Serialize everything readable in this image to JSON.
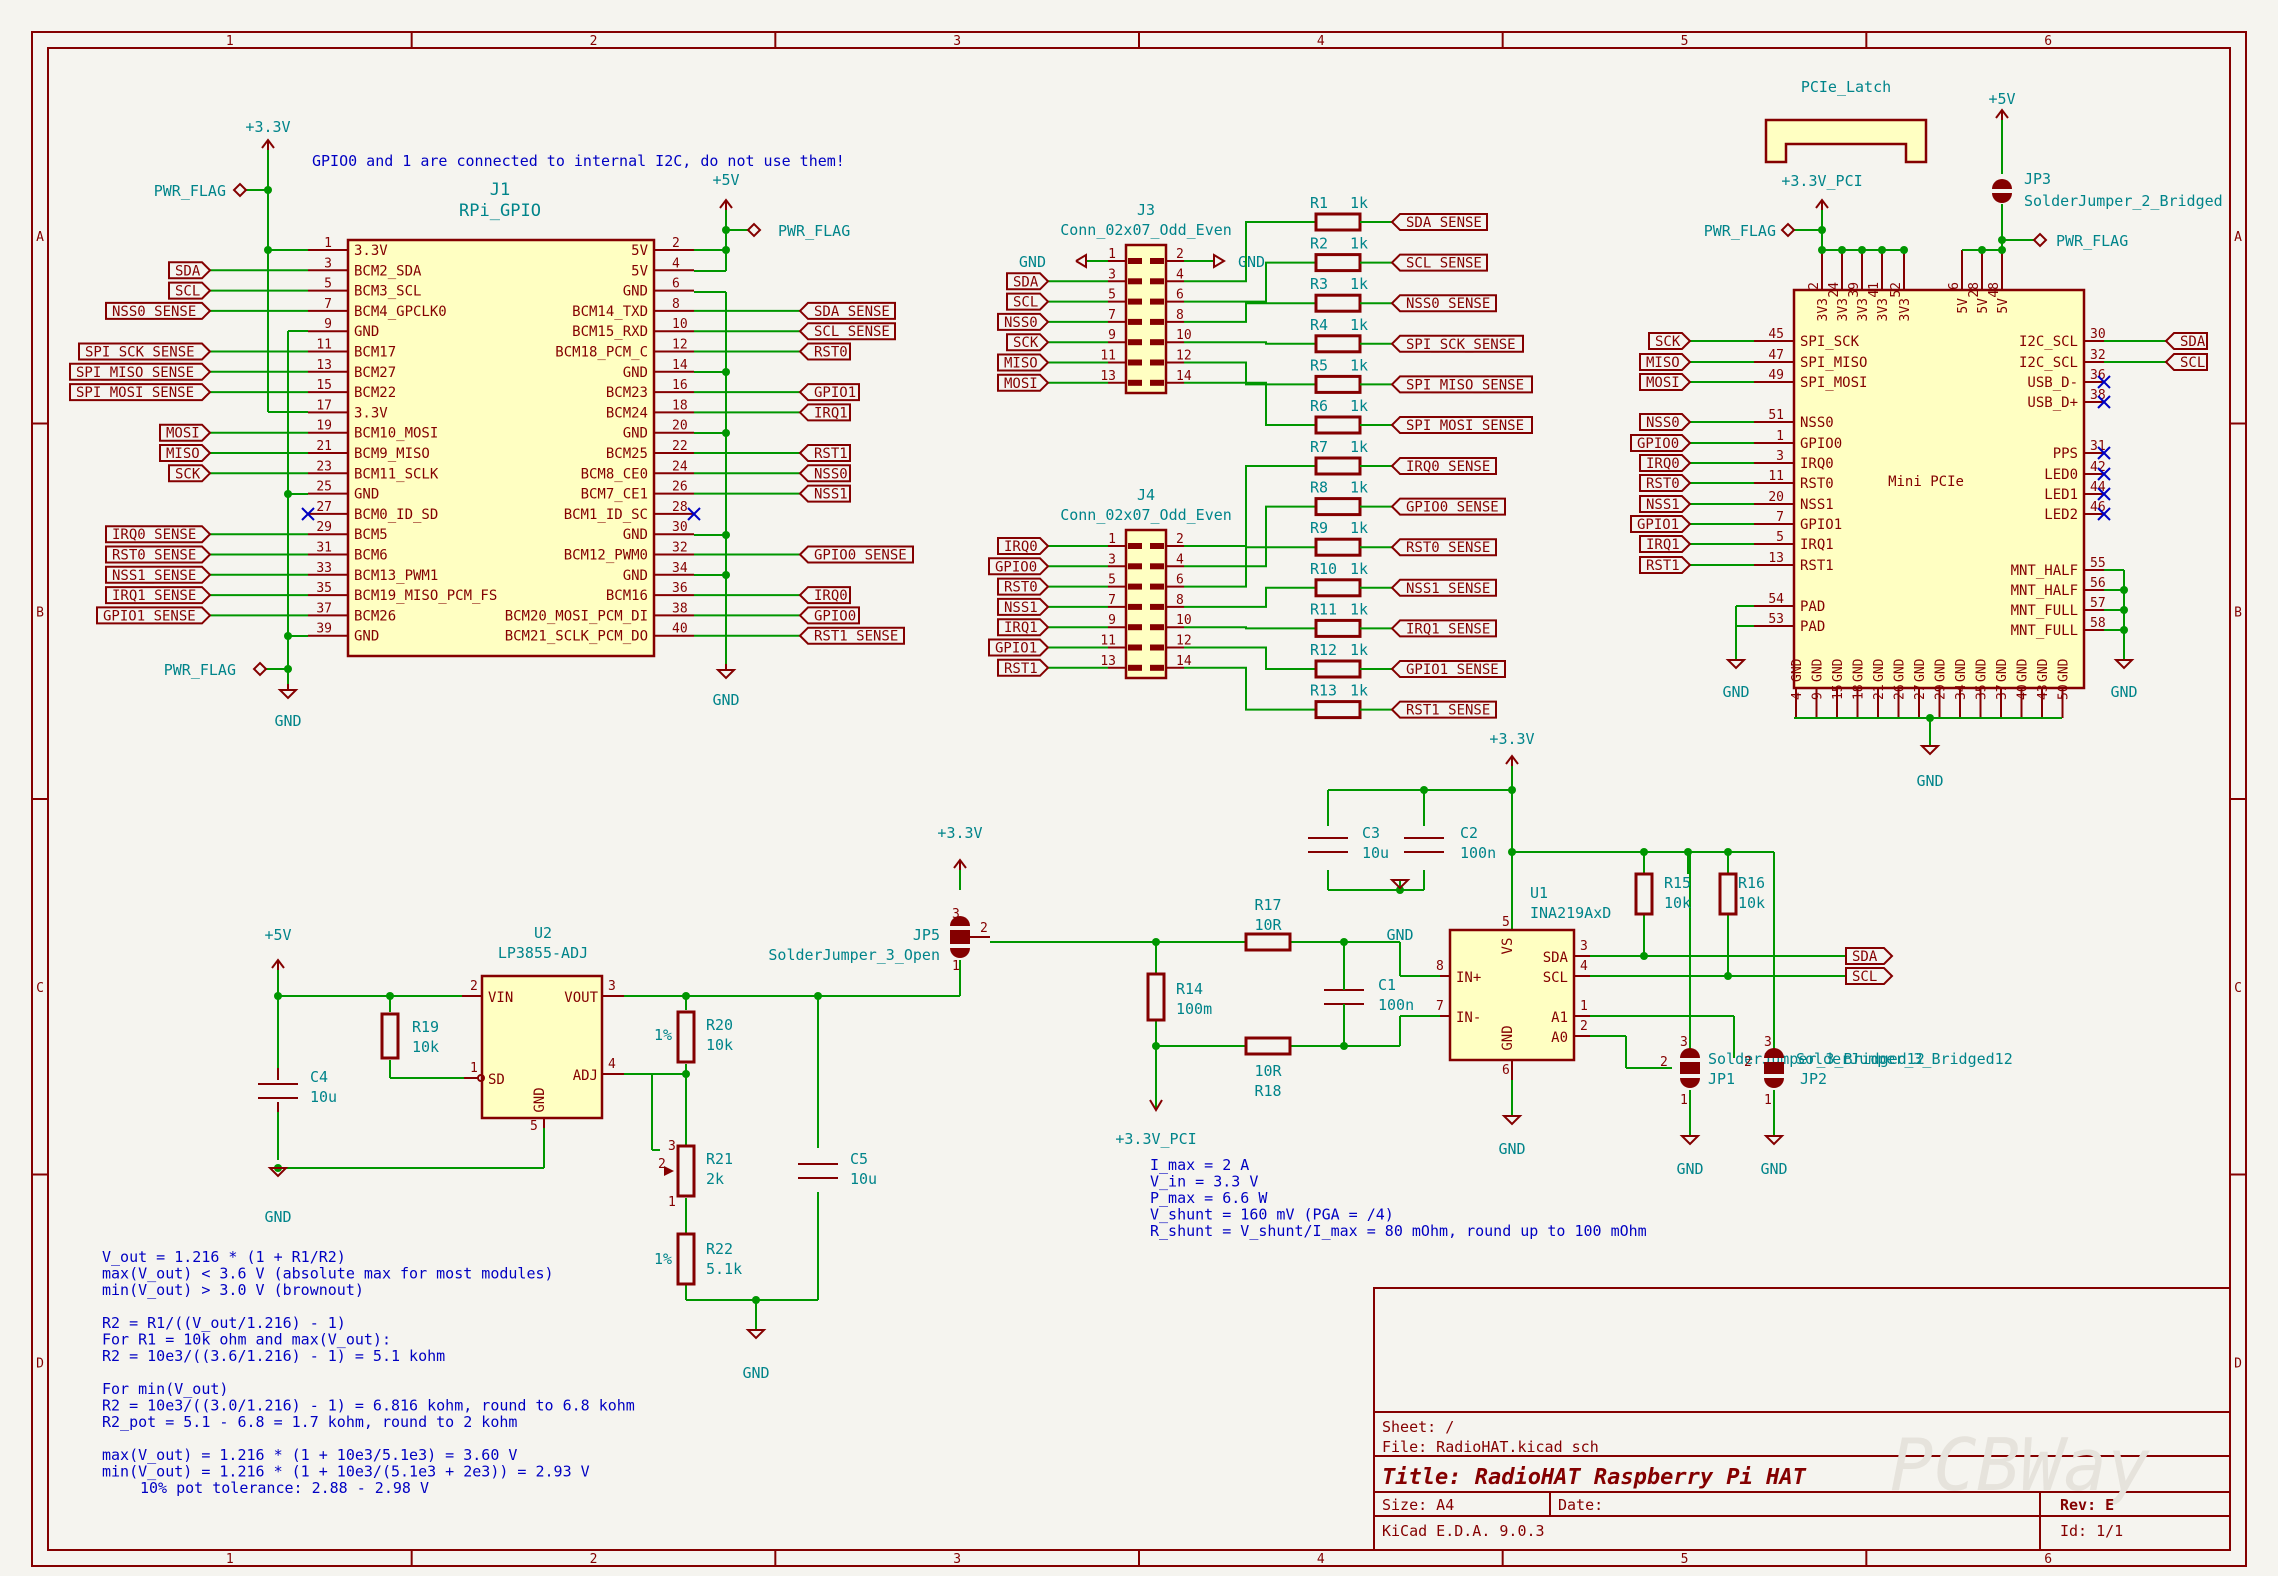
{
  "frame": {
    "cols": [
      "1",
      "2",
      "3",
      "4",
      "5",
      "6"
    ],
    "rows": [
      "A",
      "B",
      "C",
      "D"
    ]
  },
  "title_block": {
    "sheet": "Sheet: /",
    "file": "File: RadioHAT.kicad_sch",
    "title": "Title: RadioHAT Raspberry Pi HAT",
    "size": "Size: A4",
    "date": "Date:",
    "rev": "Rev: E",
    "tool": "KiCad E.D.A. 9.0.3",
    "id": "Id: 1/1",
    "watermark": "PCBWay"
  },
  "power": {
    "p33": "+3.3V",
    "p5": "+5V",
    "gnd": "GND",
    "p33pci": "+3.3V_PCI",
    "pwrflag": "PWR_FLAG"
  },
  "j1": {
    "ref": "J1",
    "value": "RPi_GPIO",
    "note": "GPIO0 and 1 are connected to internal I2C, do not use them!",
    "left": [
      {
        "n": "1",
        "t": "3.3V"
      },
      {
        "n": "3",
        "t": "BCM2_SDA"
      },
      {
        "n": "5",
        "t": "BCM3_SCL"
      },
      {
        "n": "7",
        "t": "BCM4_GPCLK0"
      },
      {
        "n": "9",
        "t": "GND"
      },
      {
        "n": "11",
        "t": "BCM17"
      },
      {
        "n": "13",
        "t": "BCM27"
      },
      {
        "n": "15",
        "t": "BCM22"
      },
      {
        "n": "17",
        "t": "3.3V"
      },
      {
        "n": "19",
        "t": "BCM10_MOSI"
      },
      {
        "n": "21",
        "t": "BCM9_MISO"
      },
      {
        "n": "23",
        "t": "BCM11_SCLK"
      },
      {
        "n": "25",
        "t": "GND"
      },
      {
        "n": "27",
        "t": "BCM0_ID_SD"
      },
      {
        "n": "29",
        "t": "BCM5"
      },
      {
        "n": "31",
        "t": "BCM6"
      },
      {
        "n": "33",
        "t": "BCM13_PWM1"
      },
      {
        "n": "35",
        "t": "BCM19_MISO_PCM_FS"
      },
      {
        "n": "37",
        "t": "BCM26"
      },
      {
        "n": "39",
        "t": "GND"
      }
    ],
    "right": [
      {
        "n": "2",
        "t": "5V"
      },
      {
        "n": "4",
        "t": "5V"
      },
      {
        "n": "6",
        "t": "GND"
      },
      {
        "n": "8",
        "t": "BCM14_TXD"
      },
      {
        "n": "10",
        "t": "BCM15_RXD"
      },
      {
        "n": "12",
        "t": "BCM18_PCM_C"
      },
      {
        "n": "14",
        "t": "GND"
      },
      {
        "n": "16",
        "t": "BCM23"
      },
      {
        "n": "18",
        "t": "BCM24"
      },
      {
        "n": "20",
        "t": "GND"
      },
      {
        "n": "22",
        "t": "BCM25"
      },
      {
        "n": "24",
        "t": "BCM8_CE0"
      },
      {
        "n": "26",
        "t": "BCM7_CE1"
      },
      {
        "n": "28",
        "t": "BCM1_ID_SC"
      },
      {
        "n": "30",
        "t": "GND"
      },
      {
        "n": "32",
        "t": "BCM12_PWM0"
      },
      {
        "n": "34",
        "t": "GND"
      },
      {
        "n": "36",
        "t": "BCM16"
      },
      {
        "n": "38",
        "t": "BCM20_MOSI_PCM_DI"
      },
      {
        "n": "40",
        "t": "BCM21_SCLK_PCM_DO"
      }
    ],
    "left_labels": [
      "",
      "SDA",
      "SCL",
      "NSS0_SENSE",
      "",
      "SPI_SCK_SENSE",
      "SPI_MISO_SENSE",
      "SPI_MOSI_SENSE",
      "",
      "MOSI",
      "MISO",
      "SCK",
      "",
      "",
      "IRQ0_SENSE",
      "RST0_SENSE",
      "NSS1_SENSE",
      "IRQ1_SENSE",
      "GPIO1_SENSE",
      ""
    ],
    "right_labels": [
      "",
      "",
      "",
      "SDA_SENSE",
      "SCL_SENSE",
      "RST0",
      "",
      "GPIO1",
      "IRQ1",
      "",
      "RST1",
      "NSS0",
      "NSS1",
      "",
      "",
      "GPIO0_SENSE",
      "",
      "IRQ0",
      "GPIO0",
      "RST1_SENSE"
    ]
  },
  "j3": {
    "ref": "J3",
    "value": "Conn_02x07_Odd_Even",
    "left_pins": [
      "1",
      "3",
      "5",
      "7",
      "9",
      "11",
      "13"
    ],
    "right_pins": [
      "2",
      "4",
      "6",
      "8",
      "10",
      "12",
      "14"
    ],
    "left_labels": [
      "",
      "SDA",
      "SCL",
      "NSS0",
      "SCK",
      "MISO",
      "MOSI"
    ],
    "gnd": "GND",
    "resistors": [
      {
        "ref": "R1",
        "val": "1k",
        "net": "SDA_SENSE"
      },
      {
        "ref": "R2",
        "val": "1k",
        "net": "SCL_SENSE"
      },
      {
        "ref": "R3",
        "val": "1k",
        "net": "NSS0_SENSE"
      },
      {
        "ref": "R4",
        "val": "1k",
        "net": "SPI_SCK_SENSE"
      },
      {
        "ref": "R5",
        "val": "1k",
        "net": "SPI_MISO_SENSE"
      },
      {
        "ref": "R6",
        "val": "1k",
        "net": "SPI_MOSI_SENSE"
      }
    ]
  },
  "j4": {
    "ref": "J4",
    "value": "Conn_02x07_Odd_Even",
    "left_pins": [
      "1",
      "3",
      "5",
      "7",
      "9",
      "11",
      "13"
    ],
    "right_pins": [
      "2",
      "4",
      "6",
      "8",
      "10",
      "12",
      "14"
    ],
    "left_labels": [
      "IRQ0",
      "GPIO0",
      "RST0",
      "NSS1",
      "IRQ1",
      "GPIO1",
      "RST1"
    ],
    "resistors": [
      {
        "ref": "R7",
        "val": "1k",
        "net": "IRQ0_SENSE"
      },
      {
        "ref": "R8",
        "val": "1k",
        "net": "GPIO0_SENSE"
      },
      {
        "ref": "R9",
        "val": "1k",
        "net": "RST0_SENSE"
      },
      {
        "ref": "R10",
        "val": "1k",
        "net": "NSS1_SENSE"
      },
      {
        "ref": "R11",
        "val": "1k",
        "net": "IRQ1_SENSE"
      },
      {
        "ref": "R12",
        "val": "1k",
        "net": "GPIO1_SENSE"
      },
      {
        "ref": "R13",
        "val": "1k",
        "net": "RST1_SENSE"
      }
    ]
  },
  "pcie": {
    "latch": "PCIe_Latch",
    "value": "Mini PCIe",
    "jp3_ref": "JP3",
    "jp3_val": "SolderJumper_2_Bridged",
    "top_pins": [
      "2",
      "24",
      "39",
      "41",
      "52",
      "6",
      "28",
      "48"
    ],
    "top_names": [
      "3V3",
      "3V3",
      "3V3",
      "3V3",
      "3V3",
      "5V",
      "5V",
      "5V"
    ],
    "left": [
      {
        "n": "45",
        "t": "SPI_SCK",
        "l": "SCK"
      },
      {
        "n": "47",
        "t": "SPI_MISO",
        "l": "MISO"
      },
      {
        "n": "49",
        "t": "SPI_MOSI",
        "l": "MOSI"
      },
      {
        "n": "51",
        "t": "NSS0",
        "l": "NSS0"
      },
      {
        "n": "1",
        "t": "GPIO0",
        "l": "GPIO0"
      },
      {
        "n": "3",
        "t": "IRQ0",
        "l": "IRQ0"
      },
      {
        "n": "11",
        "t": "RST0",
        "l": "RST0"
      },
      {
        "n": "20",
        "t": "NSS1",
        "l": "NSS1"
      },
      {
        "n": "7",
        "t": "GPIO1",
        "l": "GPIO1"
      },
      {
        "n": "5",
        "t": "IRQ1",
        "l": "IRQ1"
      },
      {
        "n": "13",
        "t": "RST1",
        "l": "RST1"
      }
    ],
    "pad": [
      {
        "n": "54",
        "t": "PAD"
      },
      {
        "n": "53",
        "t": "PAD"
      }
    ],
    "right": [
      {
        "n": "30",
        "t": "I2C_SCL",
        "l": "SDA"
      },
      {
        "n": "32",
        "t": "I2C_SCL",
        "l": "SCL"
      },
      {
        "n": "36",
        "t": "USB_D-",
        "l": ""
      },
      {
        "n": "38",
        "t": "USB_D+",
        "l": ""
      },
      {
        "n": "31",
        "t": "PPS",
        "l": ""
      },
      {
        "n": "42",
        "t": "LED0",
        "l": ""
      },
      {
        "n": "44",
        "t": "LED1",
        "l": ""
      },
      {
        "n": "46",
        "t": "LED2",
        "l": ""
      },
      {
        "n": "55",
        "t": "MNT_HALF",
        "l": ""
      },
      {
        "n": "56",
        "t": "MNT_HALF",
        "l": ""
      },
      {
        "n": "57",
        "t": "MNT_FULL",
        "l": ""
      },
      {
        "n": "58",
        "t": "MNT_FULL",
        "l": ""
      }
    ],
    "bottom_pins": [
      "4",
      "9",
      "15",
      "18",
      "21",
      "26",
      "27",
      "29",
      "34",
      "35",
      "37",
      "40",
      "43",
      "50"
    ],
    "gnd_name": "GND"
  },
  "ina": {
    "u1_ref": "U1",
    "u1_val": "INA219AxD",
    "vs": "VS",
    "inp": "IN+",
    "inn": "IN-",
    "sda": "SDA",
    "scl": "SCL",
    "a1": "A1",
    "a0": "A0",
    "gndpin": "GND",
    "pins": {
      "vs": "5",
      "inp": "8",
      "inn": "7",
      "sda": "3",
      "scl": "4",
      "a1": "1",
      "a0": "2",
      "gnd": "6"
    },
    "c3": {
      "ref": "C3",
      "val": "10u"
    },
    "c2": {
      "ref": "C2",
      "val": "100n"
    },
    "c1": {
      "ref": "C1",
      "val": "100n"
    },
    "r15": {
      "ref": "R15",
      "val": "10k"
    },
    "r16": {
      "ref": "R16",
      "val": "10k"
    },
    "r17": {
      "ref": "R17",
      "val": "10R"
    },
    "r18": {
      "ref": "R18",
      "val": "10R"
    },
    "r14": {
      "ref": "R14",
      "val": "100m"
    },
    "jp1": "JP1",
    "jp2": "JP2",
    "jp_val": "SolderJumper_3_Bridged12",
    "jp_val_overlap": "SolderJumper_3_Bridged12",
    "sda_lbl": "SDA",
    "scl_lbl": "SCL",
    "notes": [
      "I_max = 2 A",
      "V_in = 3.3 V",
      "P_max = 6.6 W",
      "V_shunt = 160 mV (PGA = /4)",
      "R_shunt = V_shunt/I_max = 80 mOhm, round up to 100 mOhm"
    ]
  },
  "ldo": {
    "u2_ref": "U2",
    "u2_val": "LP3855-ADJ",
    "vin": "VIN",
    "vout": "VOUT",
    "sd": "SD",
    "adj": "ADJ",
    "gndp": "GND",
    "pins": {
      "vin": "2",
      "vout": "3",
      "sd": "1",
      "adj": "4",
      "gnd": "5"
    },
    "c4": {
      "ref": "C4",
      "val": "10u"
    },
    "c5": {
      "ref": "C5",
      "val": "10u"
    },
    "r19": {
      "ref": "R19",
      "val": "10k"
    },
    "r20": {
      "ref": "R20",
      "val": "10k",
      "tol": "1%"
    },
    "r21": {
      "ref": "R21",
      "val": "2k"
    },
    "r22": {
      "ref": "R22",
      "val": "5.1k",
      "tol": "1%"
    },
    "jp5_ref": "JP5",
    "jp5_val": "SolderJumper_3_Open",
    "notes": [
      "V_out = 1.216 * (1 + R1/R2)",
      "max(V_out) < 3.6 V (absolute max for most modules)",
      "min(V_out) > 3.0 V (brownout)",
      "",
      "R2 = R1/((V_out/1.216) - 1)",
      "For R1 = 10k ohm and max(V_out):",
      "R2 = 10e3/((3.6/1.216) - 1) = 5.1 kohm",
      "",
      "For min(V_out)",
      "R2 = 10e3/((3.0/1.216) - 1) = 6.816 kohm, round to 6.8 kohm",
      "R2_pot = 5.1 - 6.8 = 1.7 kohm, round to 2 kohm",
      "",
      "max(V_out) = 1.216 * (1 + 10e3/5.1e3) = 3.60 V",
      "min(V_out) = 1.216 * (1 + 10e3/(5.1e3 + 2e3)) = 2.93 V",
      "10% pot tolerance: 2.88 - 2.98 V"
    ]
  }
}
